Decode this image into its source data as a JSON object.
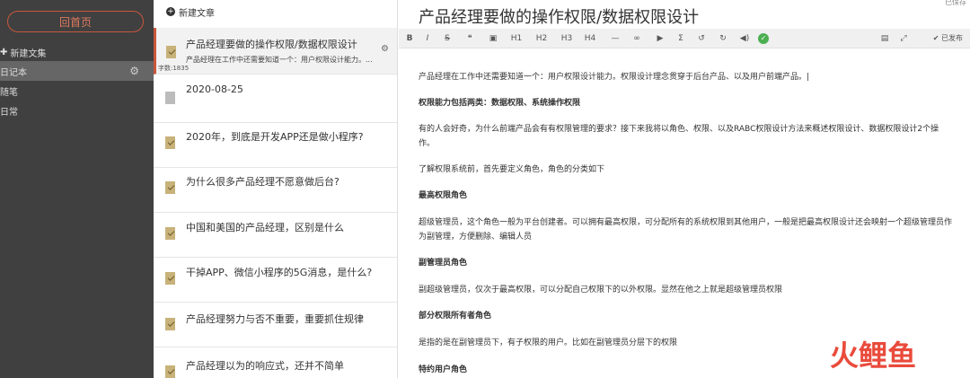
{
  "sidebar": {
    "home_label": "回首页",
    "new_notebook_label": "新建文集",
    "notebooks": [
      {
        "label": "日记本",
        "active": true
      },
      {
        "label": "随笔",
        "active": false
      },
      {
        "label": "日常",
        "active": false
      }
    ]
  },
  "list": {
    "new_article_label": "新建文章",
    "articles": [
      {
        "title": "产品经理要做的操作权限/数据权限设计",
        "snippet": "产品经理在工作中还需要知道一个：用户权限设计能力。...",
        "word_count": "字数:1835",
        "icon": "folder"
      },
      {
        "title": "2020-08-25",
        "icon": "doc"
      },
      {
        "title": "2020年，到底是开发APP还是做小程序?",
        "icon": "folder"
      },
      {
        "title": "为什么很多产品经理不愿意做后台?",
        "icon": "folder"
      },
      {
        "title": "中国和美国的产品经理，区别是什么",
        "icon": "folder"
      },
      {
        "title": "干掉APP、微信小程序的5G消息，是什么?",
        "icon": "folder"
      },
      {
        "title": "产品经理努力与否不重要，重要抓住规律",
        "icon": "folder"
      },
      {
        "title": "产品经理以为的响应式，还并不简单",
        "icon": "folder"
      }
    ]
  },
  "editor": {
    "saved_label": "已保存",
    "title": "产品经理要做的操作权限/数据权限设计",
    "toolbar": {
      "bold": "B",
      "italic": "I",
      "strike": "S",
      "quote": "❝",
      "image": "▣",
      "h1": "H1",
      "h2": "H2",
      "h3": "H3",
      "h4": "H4",
      "hr": "—",
      "link": "∞",
      "video": "▶",
      "sigma": "Σ",
      "undo": "↺",
      "redo": "↻",
      "audio": "◀)",
      "publish": "✔ 已发布"
    },
    "paragraphs": [
      {
        "text": "产品经理在工作中还需要知道一个：用户权限设计能力。权限设计理念贯穿于后台产品、以及用户前端产品。|",
        "bold": false
      },
      {
        "text": "权限能力包括两类：数据权限、系统操作权限",
        "bold": true
      },
      {
        "text": "有的人会好奇，为什么前端产品会有有权限管理的要求？接下来我将以角色、权限、以及RABC权限设计方法来概述权限设计、数据权限设计2个操作。",
        "bold": false
      },
      {
        "text": "了解权限系统前，首先要定义角色，角色的分类如下",
        "bold": false
      },
      {
        "text": "最高权限角色",
        "bold": true
      },
      {
        "text": "超级管理员，这个角色一般为平台创建者。可以拥有最高权限，可分配所有的系统权限到其他用户，一般是把最高权限设计还会映射一个超级管理员作为副管理，方便删除、编辑人员",
        "bold": false
      },
      {
        "text": "副管理员角色",
        "bold": true
      },
      {
        "text": "副超级管理员，仅次于最高权限，可以分配自己权限下的以外权限。显然在他之上就是超级管理员权限",
        "bold": false
      },
      {
        "text": "部分权限所有者角色",
        "bold": true
      },
      {
        "text": "是指的是在副管理员下，有子权限的用户。比如在副管理员分层下的权限",
        "bold": false
      },
      {
        "text": "特约用户角色",
        "bold": true
      }
    ]
  },
  "watermark": "火鲤鱼",
  "colors": {
    "accent": "#c9573c",
    "sidebar_bg": "#404040"
  }
}
